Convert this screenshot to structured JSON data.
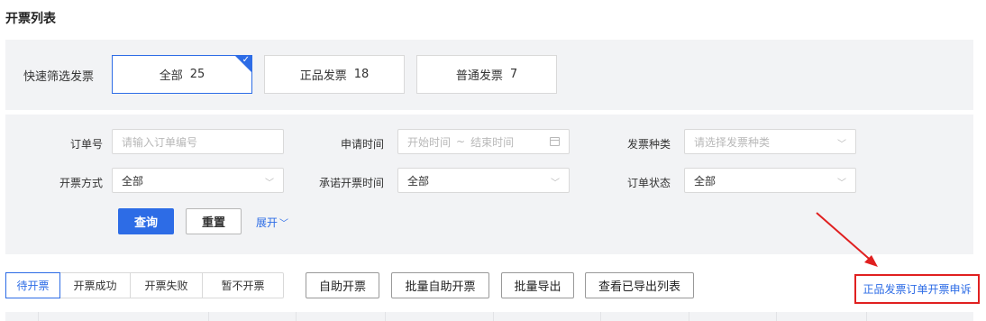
{
  "page": {
    "title": "开票列表"
  },
  "quick_filter": {
    "label": "快速筛选发票",
    "cards": [
      {
        "label": "全部",
        "count": "25",
        "active": true
      },
      {
        "label": "正品发票",
        "count": "18",
        "active": false
      },
      {
        "label": "普通发票",
        "count": "7",
        "active": false
      }
    ]
  },
  "filters": {
    "order_no": {
      "label": "订单号",
      "placeholder": "请输入订单编号"
    },
    "apply_time": {
      "label": "申请时间",
      "start_placeholder": "开始时间",
      "separator": "~",
      "end_placeholder": "结束时间"
    },
    "invoice_kind": {
      "label": "发票种类",
      "placeholder": "请选择发票种类"
    },
    "invoice_method": {
      "label": "开票方式",
      "value": "全部"
    },
    "promise_time": {
      "label": "承诺开票时间",
      "value": "全部"
    },
    "order_status": {
      "label": "订单状态",
      "value": "全部"
    },
    "query_label": "查询",
    "reset_label": "重置",
    "expand_label": "展开"
  },
  "tabs": [
    {
      "label": "待开票",
      "active": true
    },
    {
      "label": "开票成功",
      "active": false
    },
    {
      "label": "开票失败",
      "active": false
    },
    {
      "label": "暂不开票",
      "active": false
    }
  ],
  "actions": [
    {
      "label": "自助开票"
    },
    {
      "label": "批量自助开票"
    },
    {
      "label": "批量导出"
    },
    {
      "label": "查看已导出列表"
    }
  ],
  "appeal_link": "正品发票订单开票申诉",
  "colors": {
    "primary": "#2d6ce6",
    "annotation": "#e02020",
    "panel_bg": "#f2f3f5"
  }
}
